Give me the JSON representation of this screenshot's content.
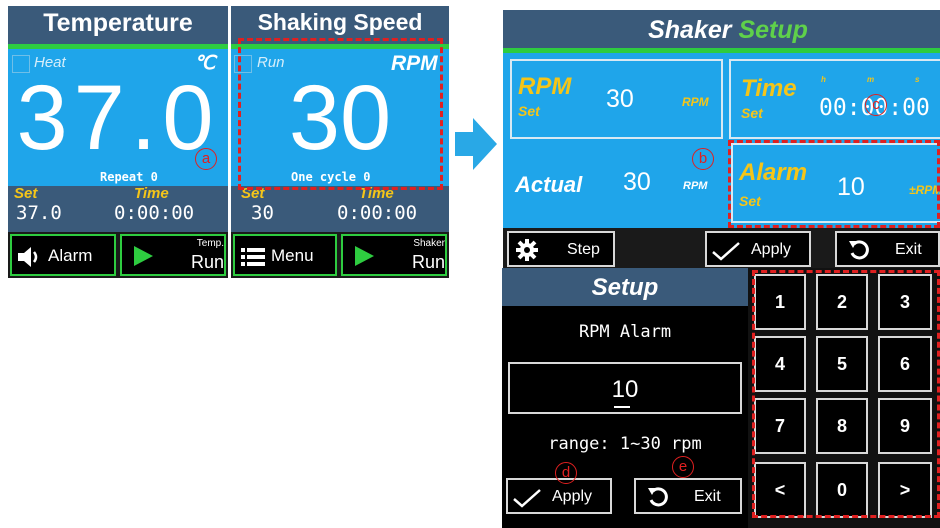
{
  "panel1": {
    "temp": {
      "title": "Temperature",
      "checkbox_label": "Heat",
      "unit": "℃",
      "value": "37.0",
      "sub_label": "Repeat",
      "sub_value": "0",
      "set_label": "Set",
      "set_value": "37.0",
      "time_label": "Time",
      "time_value": "0:00:00",
      "btn_alarm": "Alarm",
      "btn_run_top": "Temp.",
      "btn_run_bottom": "Run"
    },
    "speed": {
      "title": "Shaking Speed",
      "checkbox_label": "Run",
      "unit": "RPM",
      "value": "30",
      "sub_label": "One cycle",
      "sub_value": "0",
      "set_label": "Set",
      "set_value": "30",
      "time_label": "Time",
      "time_value": "0:00:00",
      "btn_menu": "Menu",
      "btn_run_top": "Shaker",
      "btn_run_bottom": "Run"
    },
    "callout": "a"
  },
  "shaker_setup": {
    "title_part1": "Shaker",
    "title_part2": "Setup",
    "rpm_label": "RPM",
    "rpm_set": "Set",
    "rpm_value": "30",
    "rpm_unit": "RPM",
    "time_label": "Time",
    "time_set": "Set",
    "time_h": "h",
    "time_m": "m",
    "time_s": "s",
    "time_value_h": "00",
    "time_value_m": "00",
    "time_value_s": "00",
    "actual_label": "Actual",
    "actual_value": "30",
    "actual_unit": "RPM",
    "alarm_label": "Alarm",
    "alarm_set": "Set",
    "alarm_value": "10",
    "alarm_unit": "±RPM",
    "btn_step": "Step",
    "btn_apply": "Apply",
    "btn_exit": "Exit",
    "callout_b": "b",
    "callout_c": "c"
  },
  "setup_dialog": {
    "title": "Setup",
    "field_label": "RPM Alarm",
    "input_value": "10",
    "range_text": "range: 1~30 rpm",
    "btn_apply": "Apply",
    "btn_exit": "Exit",
    "callout_d": "d",
    "callout_e": "e",
    "keys": [
      "1",
      "2",
      "3",
      "4",
      "5",
      "6",
      "7",
      "8",
      "9",
      "<",
      "0",
      ">"
    ]
  },
  "colors": {
    "screen_blue": "#1fa5ea",
    "header_dark": "#3a5a7a",
    "accent_green": "#2ecc40",
    "set_yellow": "#f5c518",
    "callout_red": "#e02020"
  }
}
